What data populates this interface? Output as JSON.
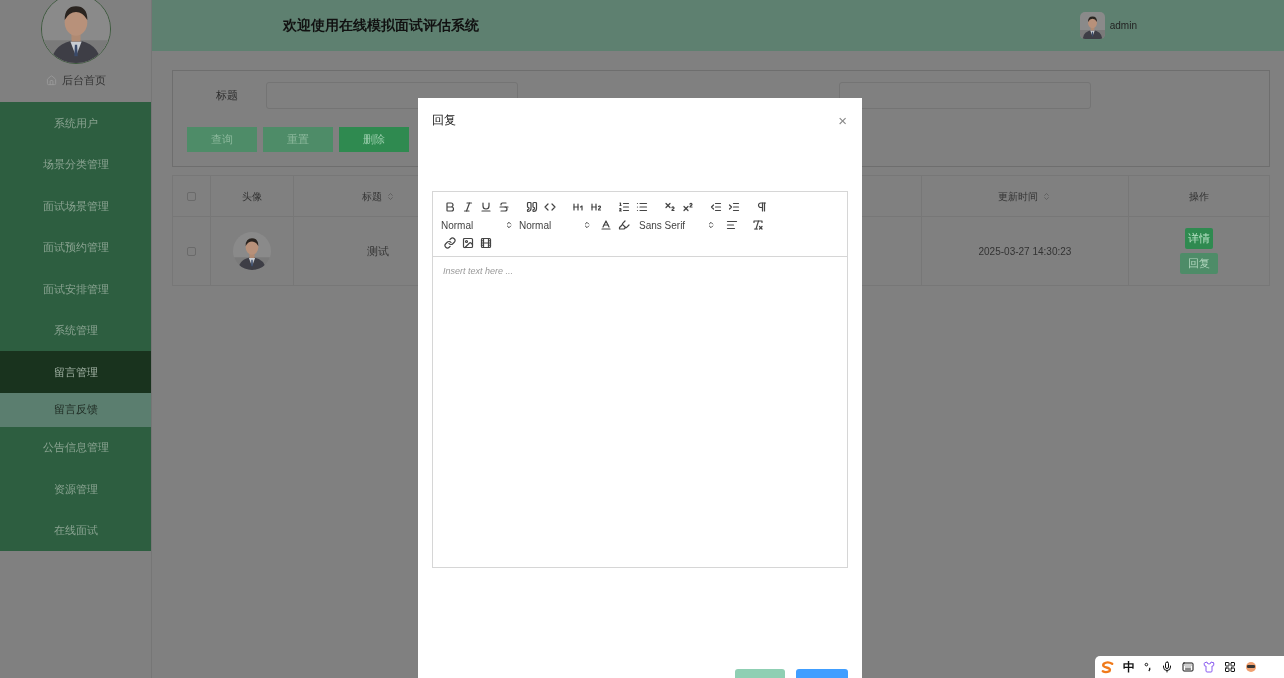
{
  "header": {
    "title": "欢迎使用在线模拟面试评估系统",
    "user": "admin"
  },
  "sidebar": {
    "home": "后台首页",
    "items": [
      {
        "label": "系统用户",
        "expanded": false
      },
      {
        "label": "场景分类管理",
        "expanded": false
      },
      {
        "label": "面试场景管理",
        "expanded": false
      },
      {
        "label": "面试预约管理",
        "expanded": false
      },
      {
        "label": "面试安排管理",
        "expanded": false
      },
      {
        "label": "系统管理",
        "expanded": false
      },
      {
        "label": "留言管理",
        "expanded": true,
        "children": [
          {
            "label": "留言反馈",
            "selected": true
          }
        ]
      },
      {
        "label": "公告信息管理",
        "expanded": false
      },
      {
        "label": "资源管理",
        "expanded": false
      },
      {
        "label": "在线面试",
        "expanded": false
      }
    ]
  },
  "search": {
    "fields": [
      {
        "label": "标题"
      }
    ],
    "buttons": [
      {
        "label": "查询",
        "kind": "default"
      },
      {
        "label": "重置",
        "kind": "default"
      },
      {
        "label": "删除",
        "kind": "delete"
      }
    ]
  },
  "table": {
    "all_checked": false,
    "columns": [
      {
        "label": "头像",
        "sortable": false
      },
      {
        "label": "标题",
        "sortable": true
      },
      {
        "label": "更新时间",
        "sortable": true
      },
      {
        "label": "操作",
        "sortable": false
      }
    ],
    "rows": [
      {
        "checked": false,
        "avatar": {
          "kind": "picture"
        },
        "title": "测试",
        "updated": "2025-03-27 14:30:23",
        "actions": [
          {
            "label": "详情",
            "kind": "detail"
          },
          {
            "label": "回复",
            "kind": "reply"
          }
        ]
      }
    ]
  },
  "dialog": {
    "title": "回复",
    "close": "×",
    "editor": {
      "pickers": [
        "Normal",
        "Normal",
        "Sans Serif"
      ],
      "placeholder": "Insert text here ..."
    }
  },
  "tray": {
    "ime": "中"
  }
}
